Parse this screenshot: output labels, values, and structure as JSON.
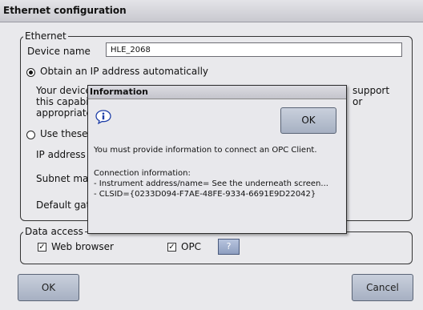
{
  "window": {
    "title": "Ethernet configuration"
  },
  "ethernet": {
    "legend": "Ethernet",
    "device_name_label": "Device name",
    "device_name_value": "HLE_2068",
    "obtain_auto_label": "Obtain an IP address automatically",
    "desc_line1": "Your device",
    "desc_line1_right": "support",
    "desc_line2": "this capabi",
    "desc_line2_right": "or",
    "desc_line3": "appropriate",
    "use_these_label": "Use these",
    "ip_address_label": "IP address",
    "subnet_label": "Subnet ma",
    "gateway_label": "Default gat"
  },
  "data_access": {
    "legend": "Data access",
    "web_browser_label": "Web browser",
    "opc_label": "OPC",
    "help_label": "?",
    "check_mark": "✓"
  },
  "buttons": {
    "ok_label": "OK",
    "cancel_label": "Cancel"
  },
  "dialog": {
    "title": "Information",
    "ok_label": "OK",
    "message": "You must provide information to connect an OPC Client.",
    "conn_header": "Connection information:",
    "conn_line1": "- Instrument address/name= See the underneath screen...",
    "conn_line2": "- CLSID={0233D094-F7AE-48FE-9334-6691E9D22042}",
    "icon": "information-icon"
  },
  "colors": {
    "button_fill": "#b0bacb",
    "help_button": "#8e9ec0",
    "background": "#e9e9ec"
  }
}
